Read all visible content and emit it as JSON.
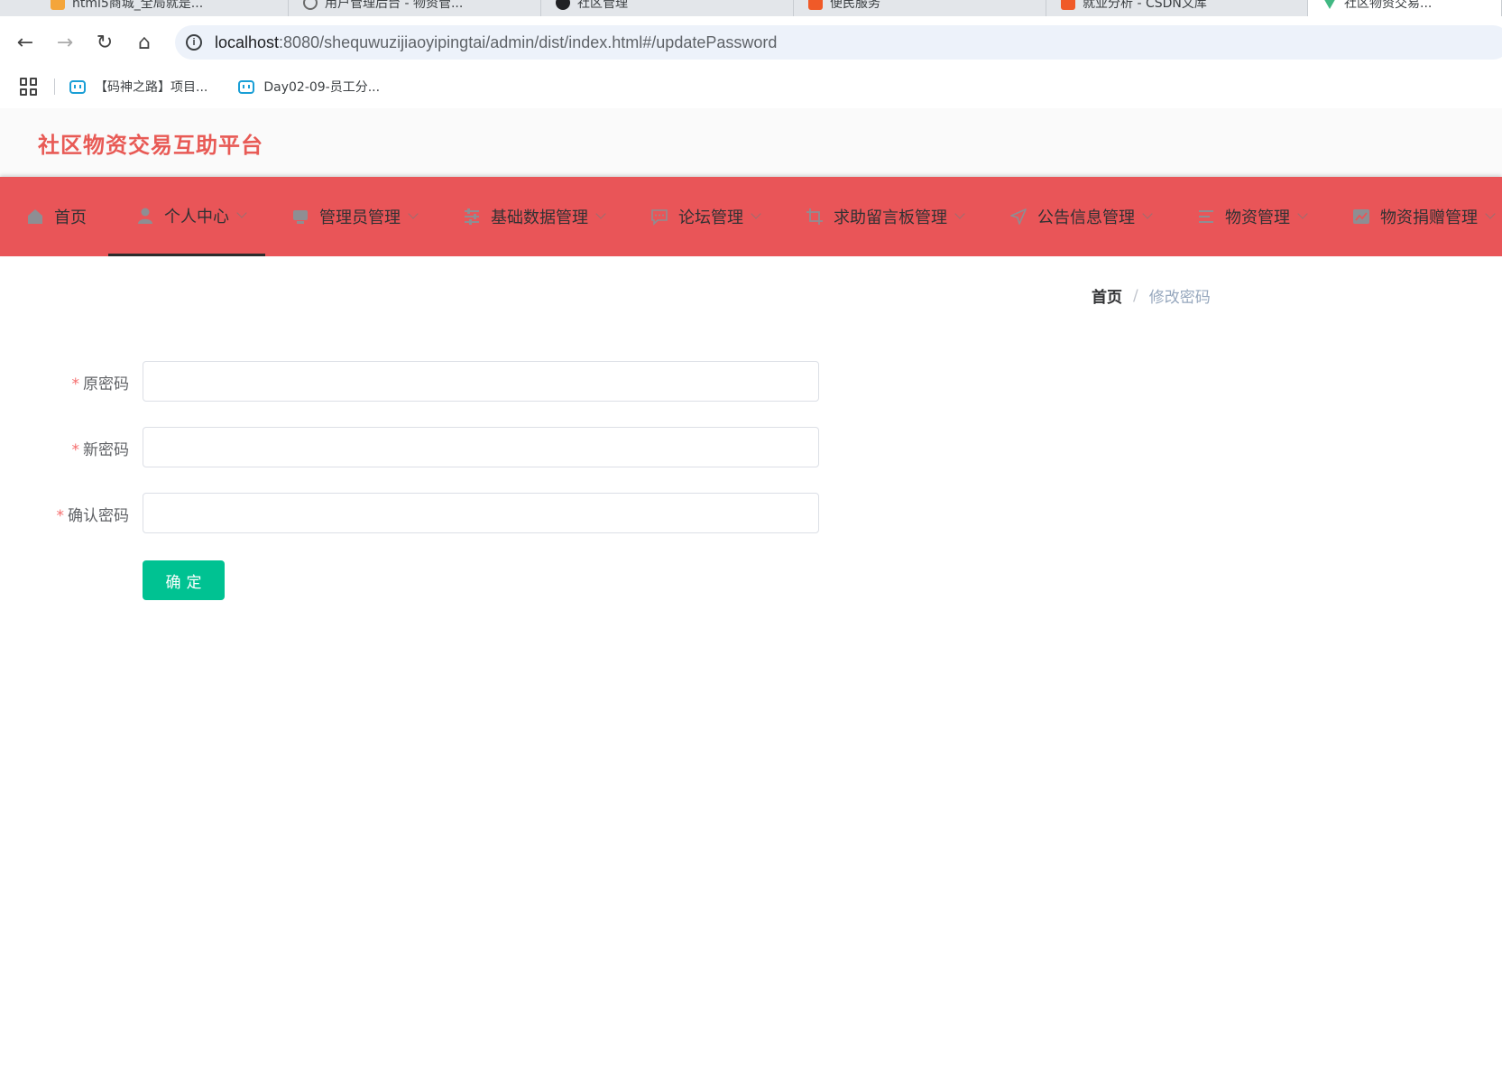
{
  "browser": {
    "tabs": [
      {
        "title": "html5商城_全局就是...",
        "favicon_color": "#f4a53a",
        "favicon": "hao-icon"
      },
      {
        "title": "用户管理后台 - 物资管...",
        "favicon_color": "#6b6b6b",
        "favicon": "search-icon"
      },
      {
        "title": "社区管理",
        "favicon_color": "#202124",
        "favicon": "github-icon"
      },
      {
        "title": "便民服务",
        "favicon_color": "#f05a28",
        "favicon": "csdn-icon"
      },
      {
        "title": "就业分析 - CSDN文库",
        "favicon_color": "#f05a28",
        "favicon": "csdn-icon"
      },
      {
        "title": "社区物资交易...",
        "favicon_color": "#41b883",
        "favicon": "vue-icon"
      }
    ],
    "url_host": "localhost",
    "url_path": ":8080/shequwuzijiaoyipingtai/admin/dist/index.html#/updatePassword",
    "bookmarks": [
      {
        "label": "【码神之路】项目..."
      },
      {
        "label": "Day02-09-员工分..."
      }
    ]
  },
  "app": {
    "title": "社区物资交易互助平台",
    "title_color": "#e85a55",
    "menu_color": "#e95558"
  },
  "menu": [
    {
      "label": "首页",
      "icon": "home-icon",
      "has_dropdown": false
    },
    {
      "label": "个人中心",
      "icon": "user-icon",
      "has_dropdown": true,
      "active": true
    },
    {
      "label": "管理员管理",
      "icon": "monitor-icon",
      "has_dropdown": true
    },
    {
      "label": "基础数据管理",
      "icon": "sliders-icon",
      "has_dropdown": true
    },
    {
      "label": "论坛管理",
      "icon": "chat-icon",
      "has_dropdown": true
    },
    {
      "label": "求助留言板管理",
      "icon": "crop-icon",
      "has_dropdown": true
    },
    {
      "label": "公告信息管理",
      "icon": "send-icon",
      "has_dropdown": true
    },
    {
      "label": "物资管理",
      "icon": "list-icon",
      "has_dropdown": true
    },
    {
      "label": "物资捐赠管理",
      "icon": "chart-icon",
      "has_dropdown": true
    }
  ],
  "breadcrumb": {
    "home": "首页",
    "separator": "/",
    "current": "修改密码"
  },
  "form": {
    "required_mark": "*",
    "old_password": {
      "label": "原密码",
      "value": ""
    },
    "new_password": {
      "label": "新密码",
      "value": ""
    },
    "confirm_password": {
      "label": "确认密码",
      "value": ""
    },
    "submit_label": "确定",
    "submit_color": "#00c292"
  }
}
